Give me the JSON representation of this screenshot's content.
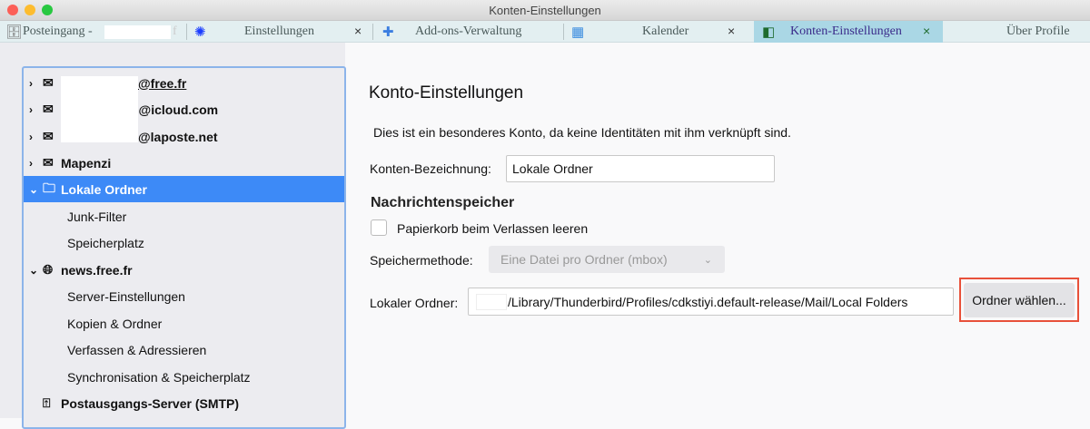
{
  "window": {
    "title": "Konten-Einstellungen"
  },
  "colors": {
    "accent": "#3d8af7",
    "selected_tab": "#aad7e5",
    "highlight": "#e8513a"
  },
  "tabs": [
    {
      "label": "Posteingang -",
      "icon": "inbox-icon",
      "suffix": "f"
    },
    {
      "label": "Einstellungen",
      "icon": "gear-icon",
      "close": "×"
    },
    {
      "label": "Add-ons-Verwaltung",
      "icon": "puzzle-icon"
    },
    {
      "label": "Kalender",
      "icon": "calendar-icon",
      "close": "×"
    },
    {
      "label": "Konten-Einstellungen",
      "icon": "account-settings-icon",
      "close": "×",
      "selected": true
    },
    {
      "label": "Über Profile"
    }
  ],
  "tree": [
    {
      "label": "@free.fr",
      "icon": "mail-icon",
      "chevron": "›"
    },
    {
      "label": "h@icloud.com",
      "icon": "mail-icon",
      "chevron": "›"
    },
    {
      "label": "@laposte.net",
      "icon": "mail-icon",
      "chevron": "›"
    },
    {
      "label": "Mapenzi",
      "icon": "mail-icon",
      "chevron": "›"
    },
    {
      "label": "Lokale Ordner",
      "icon": "folder-icon",
      "chevron": "⌄"
    },
    {
      "label": "Junk-Filter"
    },
    {
      "label": "Speicherplatz"
    },
    {
      "label": "news.free.fr",
      "icon": "globe-icon",
      "chevron": "⌄"
    },
    {
      "label": "Server-Einstellungen"
    },
    {
      "label": "Kopien & Ordner"
    },
    {
      "label": "Verfassen & Adressieren"
    },
    {
      "label": "Synchronisation & Speicherplatz"
    },
    {
      "label": "Postausgangs-Server (SMTP)",
      "icon": "outbox-icon"
    }
  ],
  "main": {
    "title": "Konto-Einstellungen",
    "info": "Dies ist ein besonderes Konto, da keine Identitäten mit ihm verknüpft sind.",
    "name_label": "Konten-Bezeichnung:",
    "name_value": "Lokale Ordner",
    "section": "Nachrichtenspeicher",
    "checkbox_label": "Papierkorb beim Verlassen leeren",
    "checkbox_checked": false,
    "method_label": "Speichermethode:",
    "method_value": "Eine Datei pro Ordner (mbox)",
    "folder_label": "Lokaler Ordner:",
    "folder_value": "/Library/Thunderbird/Profiles/cdkstiyi.default-release/Mail/Local Folders",
    "choose_button": "Ordner wählen..."
  }
}
